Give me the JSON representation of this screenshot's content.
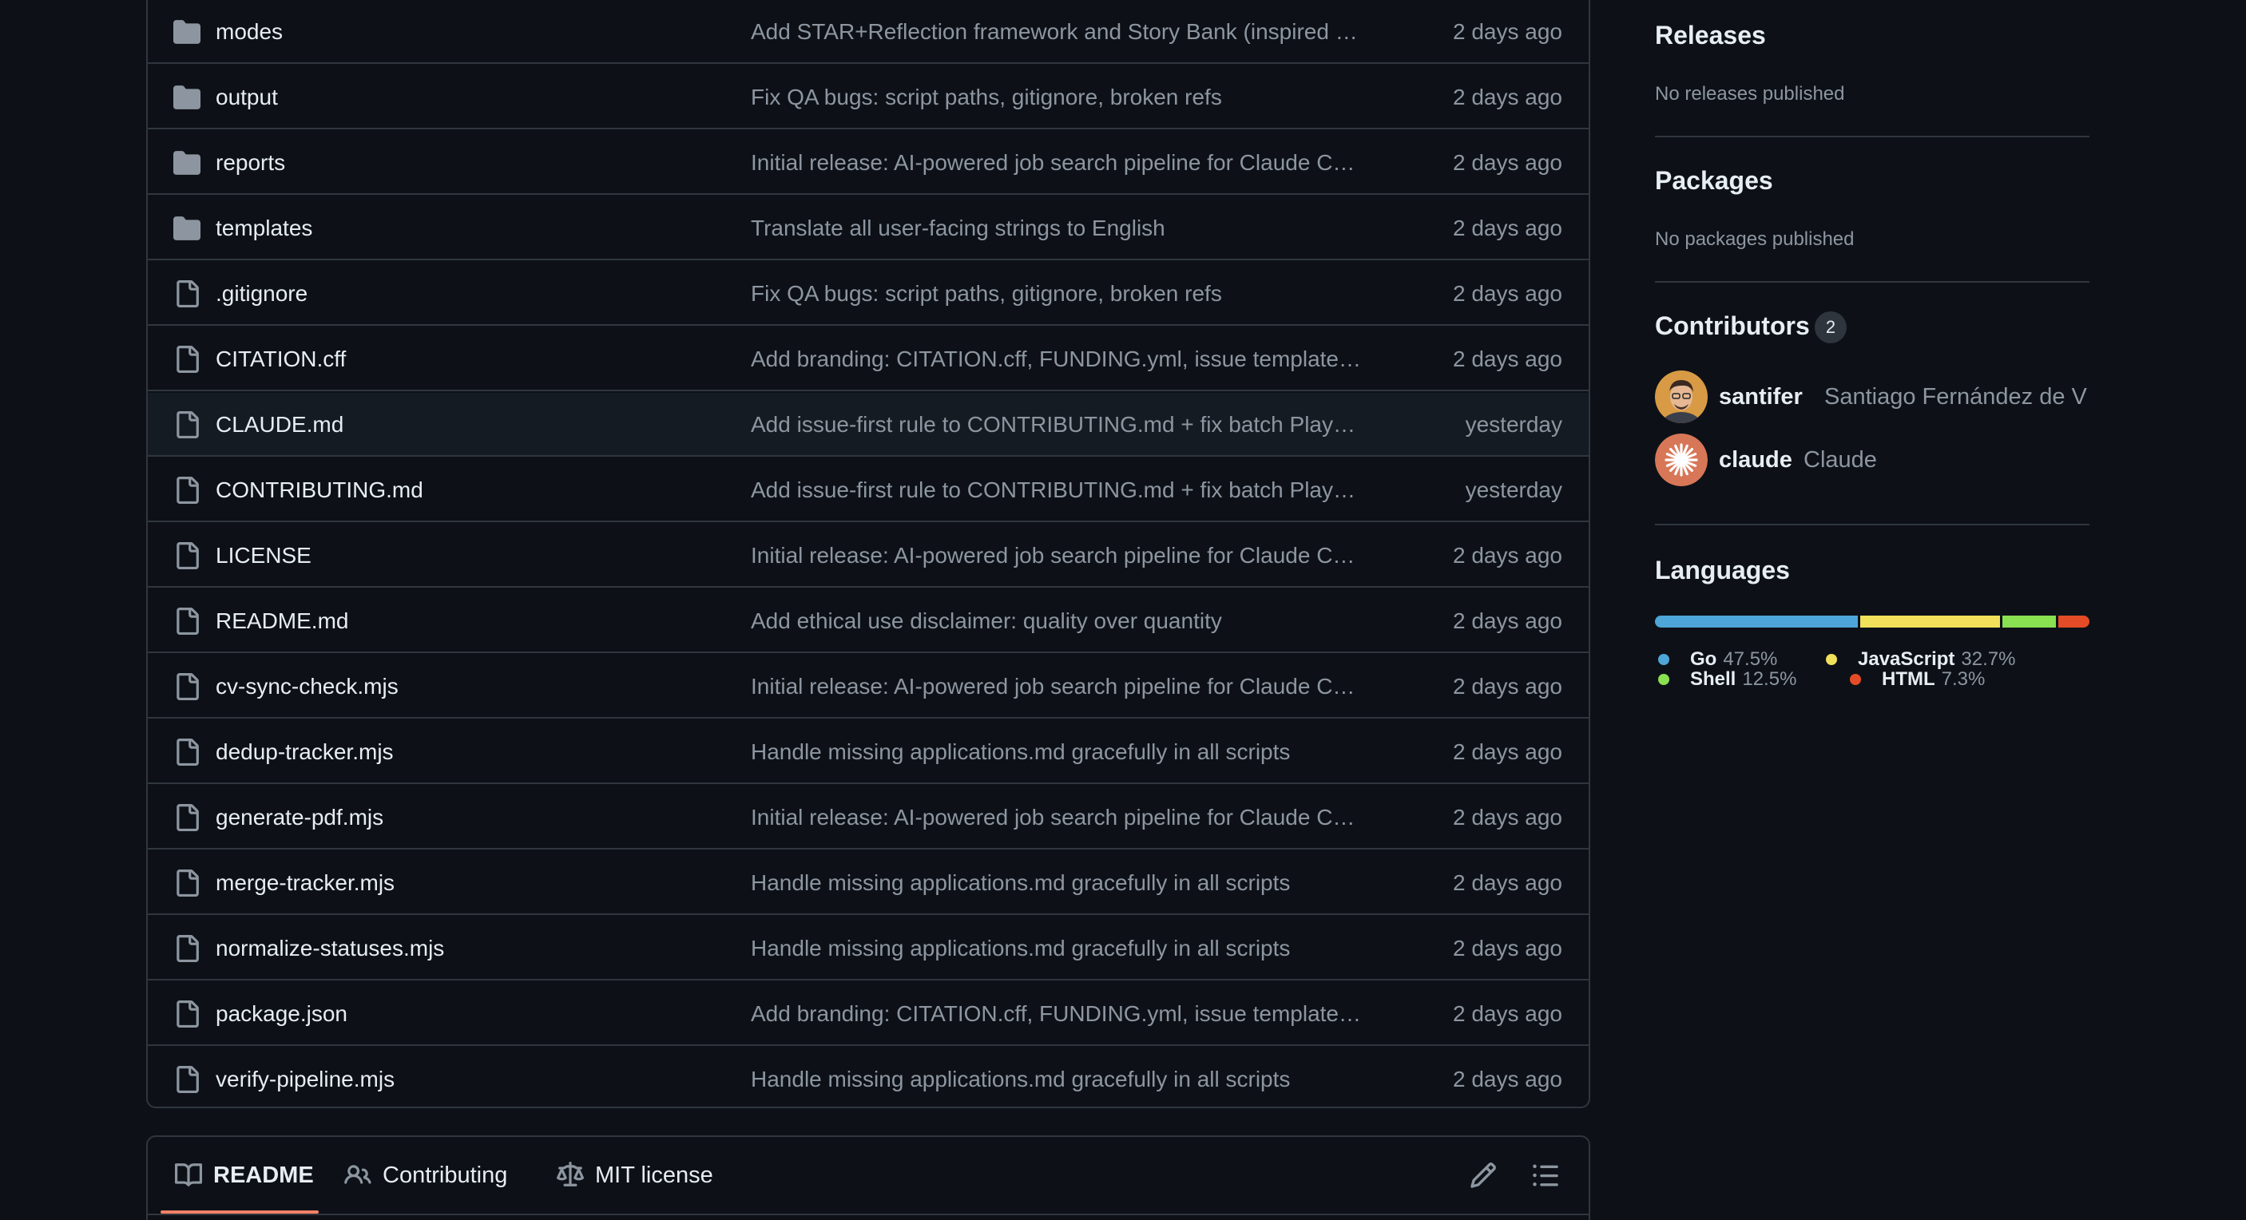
{
  "files": [
    {
      "name": "modes",
      "type": "folder",
      "message": "Add STAR+Reflection framework and Story Bank (inspired …",
      "time": "2 days ago"
    },
    {
      "name": "output",
      "type": "folder",
      "message": "Fix QA bugs: script paths, gitignore, broken refs",
      "time": "2 days ago"
    },
    {
      "name": "reports",
      "type": "folder",
      "message": "Initial release: AI-powered job search pipeline for Claude C…",
      "time": "2 days ago"
    },
    {
      "name": "templates",
      "type": "folder",
      "message": "Translate all user-facing strings to English",
      "time": "2 days ago"
    },
    {
      "name": ".gitignore",
      "type": "file",
      "message": "Fix QA bugs: script paths, gitignore, broken refs",
      "time": "2 days ago"
    },
    {
      "name": "CITATION.cff",
      "type": "file",
      "message": "Add branding: CITATION.cff, FUNDING.yml, issue template…",
      "time": "2 days ago"
    },
    {
      "name": "CLAUDE.md",
      "type": "file",
      "message": "Add issue-first rule to CONTRIBUTING.md + fix batch Play…",
      "time": "yesterday"
    },
    {
      "name": "CONTRIBUTING.md",
      "type": "file",
      "message": "Add issue-first rule to CONTRIBUTING.md + fix batch Play…",
      "time": "yesterday"
    },
    {
      "name": "LICENSE",
      "type": "file",
      "message": "Initial release: AI-powered job search pipeline for Claude C…",
      "time": "2 days ago"
    },
    {
      "name": "README.md",
      "type": "file",
      "message": "Add ethical use disclaimer: quality over quantity",
      "time": "2 days ago"
    },
    {
      "name": "cv-sync-check.mjs",
      "type": "file",
      "message": "Initial release: AI-powered job search pipeline for Claude C…",
      "time": "2 days ago"
    },
    {
      "name": "dedup-tracker.mjs",
      "type": "file",
      "message": "Handle missing applications.md gracefully in all scripts",
      "time": "2 days ago"
    },
    {
      "name": "generate-pdf.mjs",
      "type": "file",
      "message": "Initial release: AI-powered job search pipeline for Claude C…",
      "time": "2 days ago"
    },
    {
      "name": "merge-tracker.mjs",
      "type": "file",
      "message": "Handle missing applications.md gracefully in all scripts",
      "time": "2 days ago"
    },
    {
      "name": "normalize-statuses.mjs",
      "type": "file",
      "message": "Handle missing applications.md gracefully in all scripts",
      "time": "2 days ago"
    },
    {
      "name": "package.json",
      "type": "file",
      "message": "Add branding: CITATION.cff, FUNDING.yml, issue template…",
      "time": "2 days ago"
    },
    {
      "name": "verify-pipeline.mjs",
      "type": "file",
      "message": "Handle missing applications.md gracefully in all scripts",
      "time": "2 days ago"
    }
  ],
  "readme_tabs": {
    "readme": "README",
    "contributing": "Contributing",
    "license": "MIT license"
  },
  "sidebar": {
    "releases": {
      "heading": "Releases",
      "empty": "No releases published"
    },
    "packages": {
      "heading": "Packages",
      "empty": "No packages published"
    },
    "contributors": {
      "heading": "Contributors",
      "count": "2",
      "people": [
        {
          "login": "santifer",
          "full_name": "Santiago Fernández de V…"
        },
        {
          "login": "claude",
          "full_name": "Claude"
        }
      ]
    },
    "languages": {
      "heading": "Languages",
      "items": [
        {
          "name": "Go",
          "percent": "47.5%",
          "value": 47.5,
          "color": "#4ea6d8"
        },
        {
          "name": "JavaScript",
          "percent": "32.7%",
          "value": 32.7,
          "color": "#f1e05a"
        },
        {
          "name": "Shell",
          "percent": "12.5%",
          "value": 12.5,
          "color": "#89e051"
        },
        {
          "name": "HTML",
          "percent": "7.3%",
          "value": 7.3,
          "color": "#e34c26"
        }
      ]
    }
  }
}
